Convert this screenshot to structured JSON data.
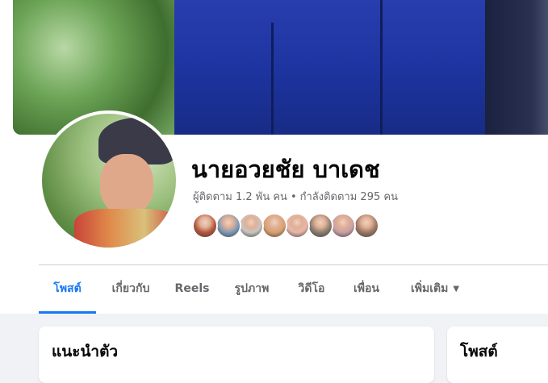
{
  "profile": {
    "name": "นายอวยชัย บาเดช",
    "followers_text": "ผู้ติดตาม 1.2 พัน คน",
    "separator": "•",
    "following_text": "กำลังติดตาม 295 คน"
  },
  "friend_avatars": [
    {
      "color": "#b5563e"
    },
    {
      "color": "#7d9bb8"
    },
    {
      "color": "#c8c5c2"
    },
    {
      "color": "#d9a06e"
    },
    {
      "color": "#e8b6a9"
    },
    {
      "color": "#8a7d6e"
    },
    {
      "color": "#c9a0a7"
    },
    {
      "color": "#9b7864"
    }
  ],
  "tabs": [
    {
      "label": "โพสต์",
      "active": true
    },
    {
      "label": "เกี่ยวกับ",
      "active": false
    },
    {
      "label": "Reels",
      "active": false
    },
    {
      "label": "รูปภาพ",
      "active": false
    },
    {
      "label": "วิดีโอ",
      "active": false
    },
    {
      "label": "เพื่อน",
      "active": false
    },
    {
      "label": "เพิ่มเติม",
      "active": false,
      "icon": "caret-down-icon"
    }
  ],
  "intro_card": {
    "title": "แนะนำตัว"
  },
  "posts_card": {
    "title": "โพสต์"
  },
  "colors": {
    "accent": "#1877f2",
    "text_primary": "#050505",
    "text_secondary": "#65676b",
    "page_background": "#f0f2f5"
  }
}
